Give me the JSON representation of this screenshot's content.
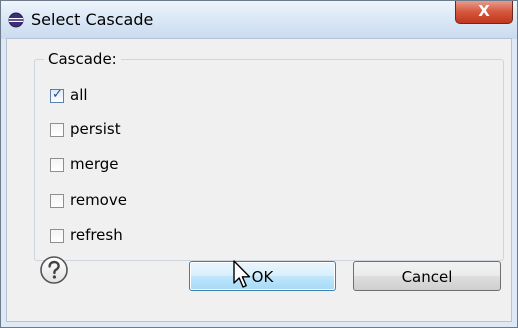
{
  "window": {
    "title": "Select Cascade",
    "close_label": "X"
  },
  "group": {
    "label": "Cascade:",
    "options": [
      {
        "label": "all",
        "checked": true
      },
      {
        "label": "persist",
        "checked": false
      },
      {
        "label": "merge",
        "checked": false
      },
      {
        "label": "remove",
        "checked": false
      },
      {
        "label": "refresh",
        "checked": false
      }
    ]
  },
  "buttons": {
    "ok_label": "OK",
    "cancel_label": "Cancel"
  },
  "icons": {
    "title": "eclipse-icon",
    "help": "help-icon",
    "cursor": "mouse-pointer-icon"
  }
}
